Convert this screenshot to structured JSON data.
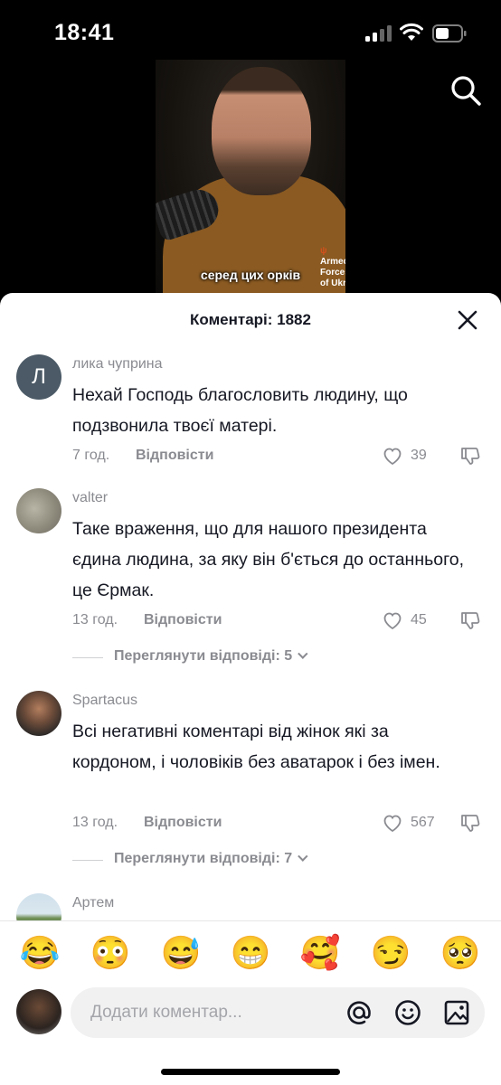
{
  "status_bar": {
    "time": "18:41"
  },
  "video": {
    "subtitle": "серед цих орків",
    "shirt_text_1": "Armed",
    "shirt_text_2": "Forces",
    "shirt_text_3": "of Ukr"
  },
  "comments_panel": {
    "title": "Коментарі: 1882",
    "comments": [
      {
        "avatar_letter": "Л",
        "username": "лика чуприна",
        "text": "Нехай Господь благословить людину, що подзвонила твоєї матері.",
        "time": "7 год.",
        "reply_label": "Відповісти",
        "likes": "39"
      },
      {
        "username": "valter",
        "text": "Таке враження, що для нашого президента єдина людина, за яку він б'ється до останнього, це Єрмак.",
        "time": "13 год.",
        "reply_label": "Відповісти",
        "likes": "45",
        "view_replies": "Переглянути відповіді: 5"
      },
      {
        "username": "Spartacus",
        "text": "Всі негативні коментарі від жінок які за кордоном, і чоловіків без аватарок і без імен.",
        "time": "13 год.",
        "reply_label": "Відповісти",
        "likes": "567",
        "view_replies": "Переглянути відповіді: 7"
      },
      {
        "username": "Артем"
      }
    ]
  },
  "emoji_bar": [
    "😂",
    "😳",
    "😅",
    "😁",
    "🥰",
    "😏",
    "🥺"
  ],
  "input": {
    "placeholder": "Додати коментар..."
  }
}
